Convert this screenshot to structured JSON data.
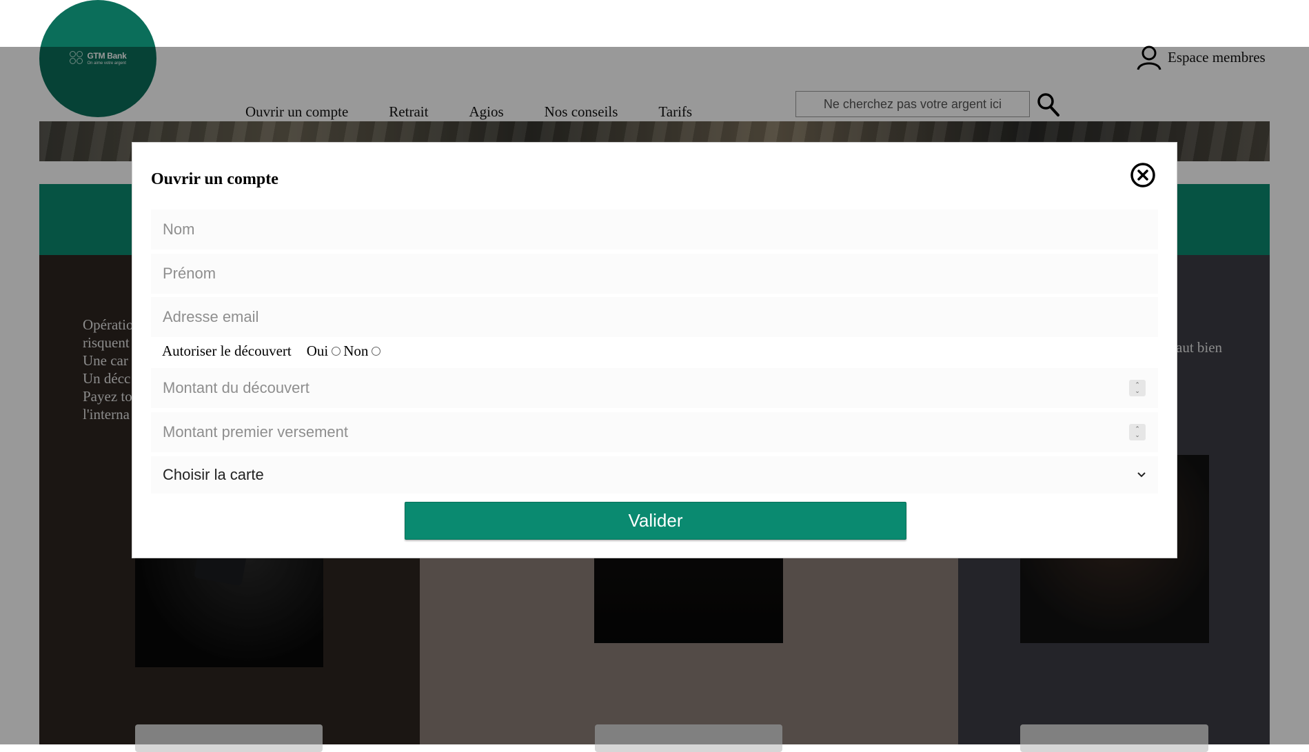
{
  "header": {
    "logo": {
      "name": "GTM Bank",
      "slogan": "On aime votre argent"
    },
    "nav": [
      {
        "label": "Ouvrir un compte"
      },
      {
        "label": "Retrait"
      },
      {
        "label": "Agios"
      },
      {
        "label": "Nos conseils"
      },
      {
        "label": "Tarifs"
      }
    ],
    "search": {
      "placeholder": "Ne cherchez pas votre argent ici",
      "icon": "search-icon"
    },
    "members": {
      "label": "Espace membres",
      "icon": "user-icon"
    }
  },
  "background_content": {
    "offer_items": [
      "Opératio",
      "risquent",
      "Une car",
      "Un décc",
      "Payez to",
      "l'interna"
    ],
    "side_text": "aut bien"
  },
  "modal": {
    "title": "Ouvrir un compte",
    "close_icon": "close-circle-icon",
    "fields": {
      "nom": {
        "placeholder": "Nom"
      },
      "prenom": {
        "placeholder": "Prénom"
      },
      "email": {
        "placeholder": "Adresse email"
      },
      "montant_decouvert": {
        "placeholder": "Montant du découvert"
      },
      "montant_versement": {
        "placeholder": "Montant premier versement"
      }
    },
    "overdraft": {
      "label": "Autoriser le découvert",
      "yes": "Oui",
      "no": "Non"
    },
    "card_select": {
      "selected": "Choisir la carte"
    },
    "submit": "Valider"
  },
  "colors": {
    "brand": "#0b6e5a",
    "accent": "#0a8a70",
    "overlay": "rgba(0,0,0,0.4)"
  }
}
